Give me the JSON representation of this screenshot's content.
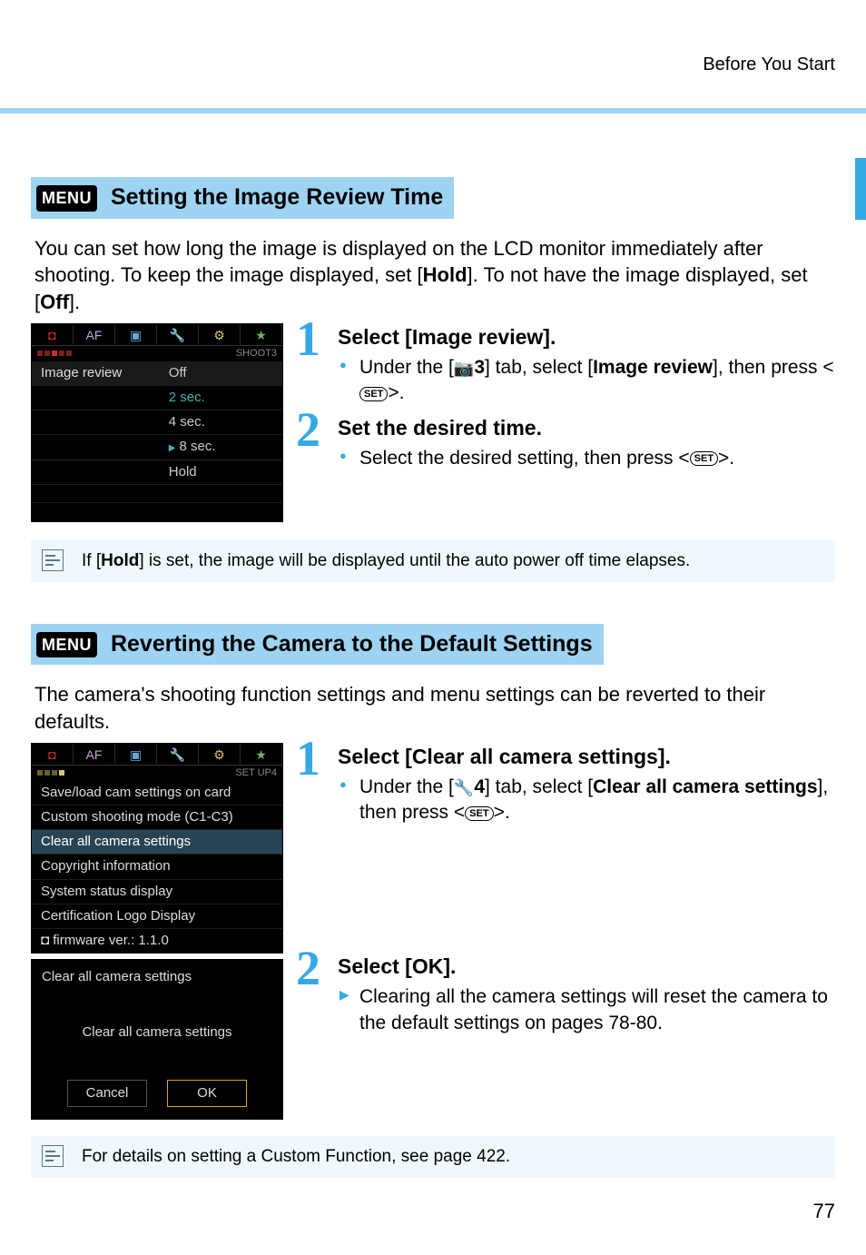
{
  "header": {
    "section": "Before You Start"
  },
  "page_number": "77",
  "menu_pill": "MENU",
  "section1": {
    "title": "Setting the Image Review Time",
    "intro_pre": "You can set how long the image is displayed on the LCD monitor immediately after shooting. To keep the image displayed, set [",
    "intro_hold": "Hold",
    "intro_mid": "]. To not have the image displayed, set [",
    "intro_off": "Off",
    "intro_post": "]."
  },
  "lcd1": {
    "tab_cam": "◘",
    "tab_af": "AF",
    "tab_play": "▣",
    "tab_wrench": "🔧",
    "tab_cfn": "⚙",
    "tab_star": "★",
    "subright": "SHOOT3",
    "row_label": "Image review",
    "opts": [
      "Off",
      "2 sec.",
      "4 sec.",
      "8 sec.",
      "Hold"
    ]
  },
  "steps1": {
    "s1_title": "Select [Image review].",
    "s1_li_pre": "Under the [",
    "s1_li_tab": "3",
    "s1_li_mid": "] tab, select [",
    "s1_li_bold": "Image review",
    "s1_li_post": "], then press <",
    "s1_li_end": ">.",
    "s2_title": "Set the desired time.",
    "s2_li": "Select the desired setting, then press <",
    "s2_li_end": ">."
  },
  "note1_pre": "If [",
  "note1_bold": "Hold",
  "note1_post": "] is set, the image will be displayed until the auto power off time elapses.",
  "section2": {
    "title": "Reverting the Camera to the Default Settings",
    "intro": "The camera's shooting function settings and menu settings can be reverted to their defaults."
  },
  "lcd2": {
    "subright": "SET UP4",
    "items": [
      "Save/load cam settings on card",
      "Custom shooting mode (C1-C3)",
      "Clear all camera settings",
      "Copyright information",
      "System status display",
      "Certification Logo Display"
    ],
    "fw_pre": "◘ firmware ver.: ",
    "fw_ver": "1.1.0"
  },
  "confirm": {
    "title": "Clear all camera settings",
    "msg": "Clear all camera settings",
    "cancel": "Cancel",
    "ok": "OK"
  },
  "steps2": {
    "s1_title": "Select [Clear all camera settings].",
    "s1_li_pre": "Under the [",
    "s1_li_tab": "4",
    "s1_li_mid": "] tab, select [",
    "s1_li_bold": "Clear all camera settings",
    "s1_li_post": "], then press <",
    "s1_li_end": ">.",
    "s2_title": "Select [OK].",
    "s2_li": "Clearing all the camera settings will reset the camera to the default settings on pages 78-80."
  },
  "note2": "For details on setting a Custom Function, see page 422.",
  "set_label": "SET"
}
